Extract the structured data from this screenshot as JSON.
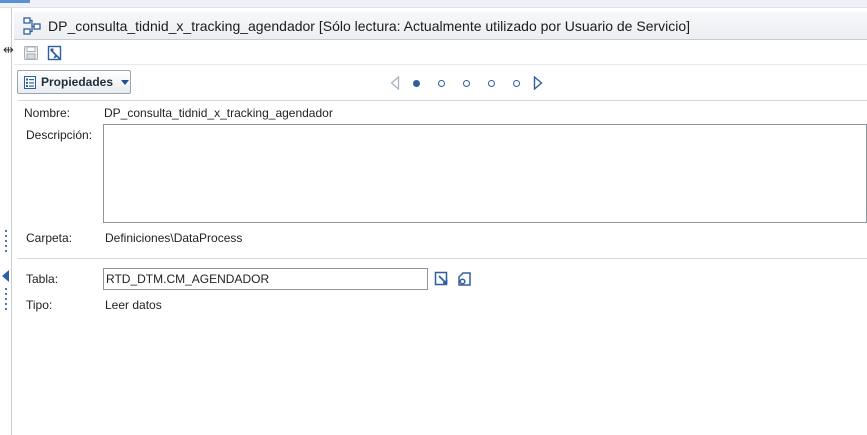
{
  "window": {
    "title": "DP_consulta_tidnid_x_tracking_agendador [Sólo lectura: Actualmente utilizado por Usuario de Servicio]"
  },
  "toolbar": {
    "icons": [
      "save-icon",
      "edit-properties-icon"
    ]
  },
  "properties_menu": {
    "label": "Propiedades"
  },
  "pager": {
    "pages": 5,
    "active_index": 0
  },
  "form": {
    "nombre_label": "Nombre:",
    "nombre_value": "DP_consulta_tidnid_x_tracking_agendador",
    "descripcion_label": "Descripción:",
    "descripcion_value": "",
    "carpeta_label": "Carpeta:",
    "carpeta_value": "Definiciones\\DataProcess",
    "tabla_label": "Tabla:",
    "tabla_value": "RTD_DTM.CM_AGENDADOR",
    "tipo_label": "Tipo:",
    "tipo_value": "Leer datos"
  },
  "colors": {
    "accent": "#2f5f9e",
    "border": "#8e959f"
  }
}
